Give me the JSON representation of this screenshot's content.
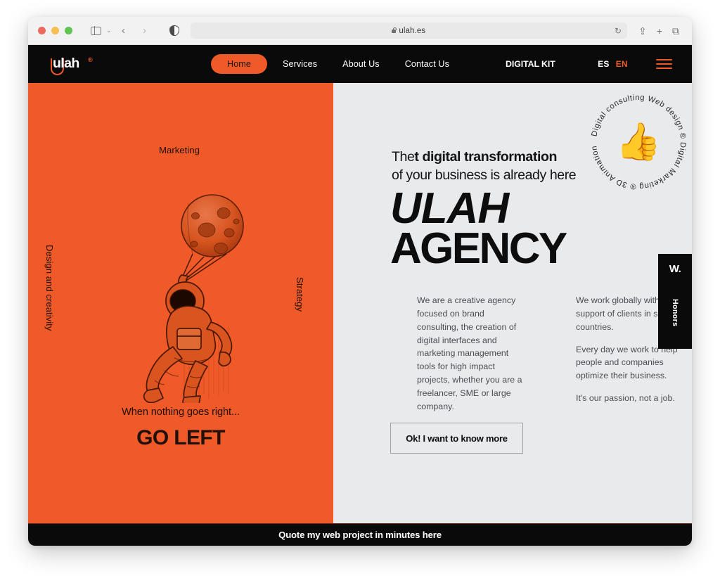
{
  "browser": {
    "url": "ulah.es",
    "lock_icon": "lock-icon",
    "reload_icon": "↻",
    "back_icon": "‹",
    "forward_icon": "›",
    "sidebar_icon": "sidebar-icon",
    "chevron_icon": "⌄",
    "shield_icon": "reader-contrast-icon",
    "share_icon": "⇪",
    "newtab_icon": "+",
    "tabs_icon": "⧉"
  },
  "nav": {
    "logo_word": "ulah",
    "logo_tm": "®",
    "links": [
      {
        "label": "Home",
        "active": true
      },
      {
        "label": "Services",
        "active": false
      },
      {
        "label": "About Us",
        "active": false
      },
      {
        "label": "Contact Us",
        "active": false
      }
    ],
    "digital_kit": "DIGITAL KIT",
    "lang_es": "ES",
    "lang_en": "EN",
    "menu_icon": "hamburger-icon"
  },
  "left": {
    "marketing": "Marketing",
    "design": "Design and creativity",
    "strategy": "Strategy",
    "tagline_1": "When nothing goes right...",
    "tagline_2": "GO LEFT",
    "illustration": "astronaut-with-moon-balloon-illustration"
  },
  "right": {
    "headline_pre": "The",
    "headline_bold": "t digital transformation",
    "headline_line2": "of your business is already here",
    "title_1": "ULAH",
    "title_2": "AGENCY",
    "col_left": [
      "We are a creative agency focused on brand consulting, the creation of digital interfaces and marketing management tools for high impact projects, whether you are a freelancer, SME or large company."
    ],
    "col_right": [
      "We work globally with the support of clients in six countries.",
      "Every day we work to help people and companies optimize their business.",
      "It's our passion, not a job."
    ],
    "cta_label": "Ok! I want to know more",
    "badge_text": "Digital consulting Web design ® Digital Marketing ® 3D Animation ® ",
    "badge_emoji": "👍",
    "honors_w": "W.",
    "honors_label": "Honors"
  },
  "banner": {
    "text": "Quote my web project in minutes here"
  },
  "colors": {
    "orange": "#ef5a28",
    "black": "#0a0a0a",
    "grey_bg": "#e9eaec",
    "body_text": "#4a4d52"
  }
}
